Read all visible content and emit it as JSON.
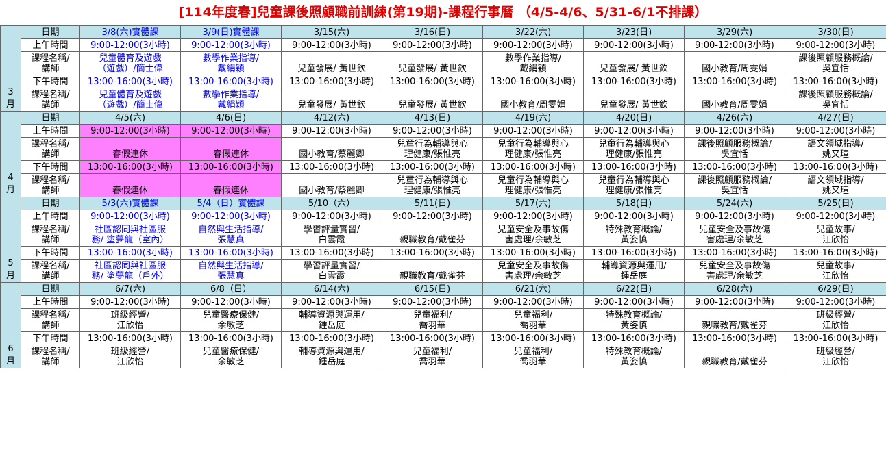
{
  "title": "[114年度春]兒童課後照顧職前訓練(第19期)-課程行事曆 （4/5-4/6、5/31-6/1不排課）",
  "labels": {
    "date": "日期",
    "am": "上午時間",
    "pm": "下午時間",
    "course_l1": "課程名稱/",
    "course_l2": "講師"
  },
  "colors": {
    "header_bg": "#bfe3ea",
    "title": "#e00000",
    "physical_class": "#0000ee",
    "holiday_bg": "#ff80ff"
  },
  "blocks": [
    {
      "month": [
        "3",
        "月"
      ],
      "dates": [
        "3/8(六)實體課",
        "3/9(日)實體課",
        "3/15(六)",
        "3/16(日)",
        "3/22(六)",
        "3/23(日)",
        "3/29(六)",
        "3/30(日)"
      ],
      "am_times": [
        "9:00-12:00(3小時)",
        "9:00-12:00(3小時)",
        "9:00-12:00(3小時)",
        "9:00-12:00(3小時)",
        "9:00-12:00(3小時)",
        "9:00-12:00(3小時)",
        "9:00-12:00(3小時)",
        "9:00-12:00(3小時)"
      ],
      "am_courses": [
        [
          "兒童體育及遊戲",
          "（遊戲）/簡士偉"
        ],
        [
          "數學作業指導/",
          "戴絹穎"
        ],
        [
          "",
          "兒童發展/ 黃世欽"
        ],
        [
          "",
          "兒童發展/ 黃世欽"
        ],
        [
          "數學作業指導/",
          "戴絹穎"
        ],
        [
          "",
          "兒童發展/ 黃世欽"
        ],
        [
          "",
          "國小教育/周雯娟"
        ],
        [
          "課後照顧服務概論/",
          "吳宜恬"
        ]
      ],
      "pm_times": [
        "13:00-16:00(3小時)",
        "13:00-16:00(3小時)",
        "13:00-16:00(3小時)",
        "13:00-16:00(3小時)",
        "13:00-16:00(3小時)",
        "13:00-16:00(3小時)",
        "13:00-16:00(3小時)",
        "13:00-16:00(3小時)"
      ],
      "pm_courses": [
        [
          "兒童體育及遊戲",
          "（遊戲）/簡士偉"
        ],
        [
          "數學作業指導/",
          "戴絹穎"
        ],
        [
          "",
          "兒童發展/ 黃世欽"
        ],
        [
          "",
          "兒童發展/ 黃世欽"
        ],
        [
          "",
          "國小教育/周雯娟"
        ],
        [
          "",
          "兒童發展/ 黃世欽"
        ],
        [
          "",
          "國小教育/周雯娟"
        ],
        [
          "課後照顧服務概論/",
          "吳宜恬"
        ]
      ]
    },
    {
      "month": [
        "4",
        "月"
      ],
      "dates": [
        "4/5(六)",
        "4/6(日)",
        "4/12(六)",
        "4/13(日)",
        "4/19(六)",
        "4/20(日)",
        "4/26(六)",
        "4/27(日)"
      ],
      "am_times": [
        "9:00-12:00(3小時)",
        "9:00-12:00(3小時)",
        "9:00-12:00(3小時)",
        "9:00-12:00(3小時)",
        "9:00-12:00(3小時)",
        "9:00-12:00(3小時)",
        "9:00-12:00(3小時)",
        "9:00-12:00(3小時)"
      ],
      "am_courses": [
        [
          "",
          "春假連休"
        ],
        [
          "",
          "春假連休"
        ],
        [
          "",
          "國小教育/蔡麗卿"
        ],
        [
          "兒童行為輔導與心",
          "理健康/張惟亮"
        ],
        [
          "兒童行為輔導與心",
          "理健康/張惟亮"
        ],
        [
          "兒童行為輔導與心",
          "理健康/張惟亮"
        ],
        [
          "課後照顧服務概論/",
          "吳宜恬"
        ],
        [
          "語文領域指導/",
          "姚又瑄"
        ]
      ],
      "pm_times": [
        "13:00-16:00(3小時)",
        "13:00-16:00(3小時)",
        "13:00-16:00(3小時)",
        "13:00-16:00(3小時)",
        "13:00-16:00(3小時)",
        "13:00-16:00(3小時)",
        "13:00-16:00(3小時)",
        "13:00-16:00(3小時)"
      ],
      "pm_courses": [
        [
          "",
          "春假連休"
        ],
        [
          "",
          "春假連休"
        ],
        [
          "",
          "國小教育/蔡麗卿"
        ],
        [
          "兒童行為輔導與心",
          "理健康/張惟亮"
        ],
        [
          "兒童行為輔導與心",
          "理健康/張惟亮"
        ],
        [
          "兒童行為輔導與心",
          "理健康/張惟亮"
        ],
        [
          "課後照顧服務概論/",
          "吳宜恬"
        ],
        [
          "語文領域指導/",
          "姚又瑄"
        ]
      ]
    },
    {
      "month": [
        "5",
        "月"
      ],
      "dates": [
        "5/3(六)實體課",
        "5/4（日）實體課",
        "5/10（六）",
        "5/11(日)",
        "5/17(六)",
        "5/18(日)",
        "5/24(六)",
        "5/25(日)"
      ],
      "am_times": [
        "9:00-12:00(3小時)",
        "9:00-12:00(3小時)",
        "9:00-12:00(3小時)",
        "9:00-12:00(3小時)",
        "9:00-12:00(3小時)",
        "9:00-12:00(3小時)",
        "9:00-12:00(3小時)",
        "9:00-12:00(3小時)"
      ],
      "am_courses": [
        [
          "社區認同與社區服",
          "務/ 塗夢龍（室內）"
        ],
        [
          "自然與生活指導/",
          "張慧真"
        ],
        [
          "學習評量實習/",
          "白雲霞"
        ],
        [
          "",
          "親職教育/戴雀芬"
        ],
        [
          "兒童安全及事故傷",
          "害處理/余敏芝"
        ],
        [
          "特殊教育概論/",
          "黃姿慎"
        ],
        [
          "兒童安全及事故傷",
          "害處理/余敏芝"
        ],
        [
          "兒童故事/",
          "江欣怡"
        ]
      ],
      "pm_times": [
        "13:00-16:00(3小時)",
        "13:00-16:00(3小時)",
        "13:00-16:00(3小時)",
        "13:00-16:00(3小時)",
        "13:00-16:00(3小時)",
        "13:00-16:00(3小時)",
        "13:00-16:00(3小時)",
        "13:00-16:00(3小時)"
      ],
      "pm_courses": [
        [
          "社區認同與社區服",
          "務/ 塗夢龍（戶外）"
        ],
        [
          "自然與生活指導/",
          "張慧真"
        ],
        [
          "學習評量實習/",
          "白雲霞"
        ],
        [
          "",
          "親職教育/戴雀芬"
        ],
        [
          "兒童安全及事故傷",
          "害處理/余敏芝"
        ],
        [
          "輔導資源與運用/",
          "鍾岳庭"
        ],
        [
          "兒童安全及事故傷",
          "害處理/余敏芝"
        ],
        [
          "兒童故事/",
          "江欣怡"
        ]
      ]
    },
    {
      "month": [
        "6",
        "月"
      ],
      "dates": [
        "6/7(六)",
        "6/8（日）",
        "6/14(六)",
        "6/15(日)",
        "6/21(六)",
        "6/22(日)",
        "6/28(六)",
        "6/29(日)"
      ],
      "am_times": [
        "9:00-12:00(3小時)",
        "9:00-12:00(3小時)",
        "9:00-12:00(3小時)",
        "9:00-12:00(3小時)",
        "9:00-12:00(3小時)",
        "9:00-12:00(3小時)",
        "9:00-12:00(3小時)",
        "9:00-12:00(3小時)"
      ],
      "am_courses": [
        [
          "班級經營/",
          "江欣怡"
        ],
        [
          "兒童醫療保健/",
          "余敏芝"
        ],
        [
          "輔導資源與運用/",
          "鍾岳庭"
        ],
        [
          "兒童福利/",
          "喬羽華"
        ],
        [
          "兒童福利/",
          "喬羽華"
        ],
        [
          "特殊教育概論/",
          "黃姿慎"
        ],
        [
          "",
          "親職教育/戴雀芬"
        ],
        [
          "班級經營/",
          "江欣怡"
        ]
      ],
      "pm_times": [
        "13:00-16:00(3小時)",
        "13:00-16:00(3小時)",
        "13:00-16:00(3小時)",
        "13:00-16:00(3小時)",
        "13:00-16:00(3小時)",
        "13:00-16:00(3小時)",
        "13:00-16:00(3小時)",
        "13:00-16:00(3小時)"
      ],
      "pm_courses": [
        [
          "班級經營/",
          "江欣怡"
        ],
        [
          "兒童醫療保健/",
          "余敏芝"
        ],
        [
          "輔導資源與運用/",
          "鍾岳庭"
        ],
        [
          "兒童福利/",
          "喬羽華"
        ],
        [
          "兒童福利/",
          "喬羽華"
        ],
        [
          "特殊教育概論/",
          "黃姿慎"
        ],
        [
          "",
          "親職教育/戴雀芬"
        ],
        [
          "班級經營/",
          "江欣怡"
        ]
      ]
    }
  ]
}
